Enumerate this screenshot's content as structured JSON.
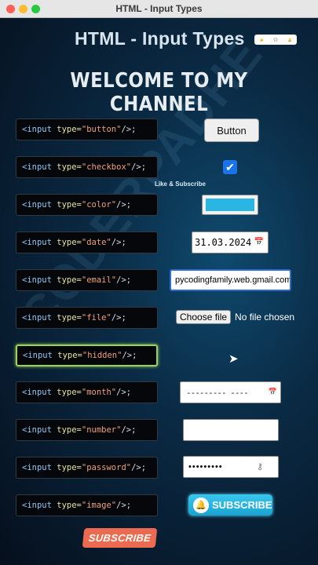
{
  "window": {
    "title": "HTML - Input Types"
  },
  "heading": "HTML - Input Types",
  "welcome": "WELCOME TO MY CHANNEL",
  "watermark": "CODERPADHE",
  "overlay": {
    "like_subscribe": "Like & Subscribe"
  },
  "code_lines": [
    {
      "open": "<input",
      "attr": "type=",
      "value": "\"button\"",
      "close": " />;"
    },
    {
      "open": "<input",
      "attr": "type=",
      "value": "\"checkbox\"",
      "close": " />;"
    },
    {
      "open": "<input",
      "attr": "type=",
      "value": "\"color\"",
      "close": " />;"
    },
    {
      "open": "<input",
      "attr": "type=",
      "value": "\"date\"",
      "close": " />;"
    },
    {
      "open": "<input",
      "attr": "type=",
      "value": "\"email\"",
      "close": " />;"
    },
    {
      "open": "<input",
      "attr": "type=",
      "value": "\"file\"",
      "close": " />;"
    },
    {
      "open": "<input",
      "attr": "type=",
      "value": "\"hidden\"",
      "close": " />;"
    },
    {
      "open": "<input",
      "attr": "type=",
      "value": "\"month\"",
      "close": " />;"
    },
    {
      "open": "<input",
      "attr": "type=",
      "value": "\"number\"",
      "close": " />;"
    },
    {
      "open": "<input",
      "attr": "type=",
      "value": "\"password\"",
      "close": " />;"
    },
    {
      "open": "<input",
      "attr": "type=",
      "value": "\"image\"",
      "close": " />;"
    }
  ],
  "inputs": {
    "button_label": "Button",
    "checkbox_checked": true,
    "color_value": "#29b6e3",
    "date_value": "31.03.2024",
    "email_value": "pycodingfamily.web.gmail.com",
    "file_button": "Choose file",
    "file_status": "No file chosen",
    "month_value": "--------- ----",
    "number_value": "",
    "password_value": "•••••••••",
    "image_label": "SUBSCRIBE"
  },
  "subscribe_button": "SUBSCRIBE",
  "colors": {
    "accent_blue": "#1a73e8",
    "active_border": "#9ad35a",
    "subscribe_red": "#ec6a50",
    "subscribe_cyan": "#29b6e3"
  }
}
